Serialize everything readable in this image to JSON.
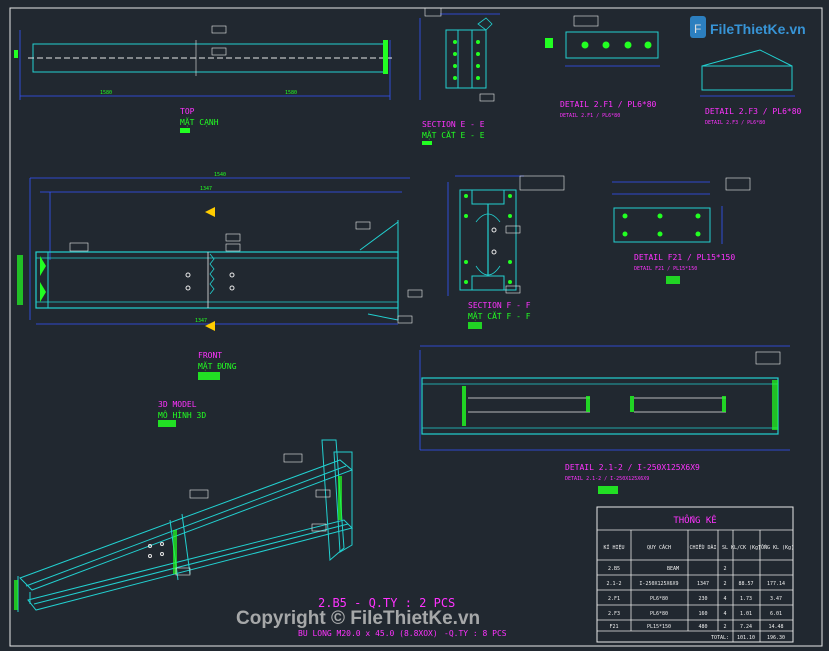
{
  "watermark": {
    "brand": "FileThietKe.vn",
    "copyright": "Copyright © FileThietKe.vn"
  },
  "views": {
    "top": {
      "title": "TOP",
      "subtitle": "MẶT CẠNH"
    },
    "section_ee": {
      "title": "SECTION E - E",
      "subtitle": "MẶT CẮT E - E"
    },
    "detail_2f1": {
      "title": "DETAIL 2.F1 / PL6*80",
      "subtitle": "DETAIL 2.F1 / PL6*80"
    },
    "detail_2f3": {
      "title": "DETAIL 2.F3 / PL6*80",
      "subtitle": "DETAIL 2.F3 / PL6*80"
    },
    "front": {
      "title": "FRONT",
      "subtitle": "MẶT ĐỨNG"
    },
    "section_ff": {
      "title": "SECTION F - F",
      "subtitle": "MẶT CẮT F - F"
    },
    "detail_f21": {
      "title": "DETAIL F21 / PL15*150",
      "subtitle": "DETAIL F21 / PL15*150"
    },
    "model3d": {
      "title": "3D MODEL",
      "subtitle": "MÔ HÌNH 3D"
    },
    "detail_212": {
      "title": "DETAIL 2.1-2 / I-250X125X6X9",
      "subtitle": "DETAIL 2.1-2 / I-250X125X6X9"
    }
  },
  "bottom": {
    "title": "2.B5 - Q.TY : 2 PCS",
    "bolt_note": "BU LONG M20.0 x 45.0 (8.8XOX)",
    "bolt_qty": "-Q.TY : 8 PCS"
  },
  "stats_table": {
    "title": "THỐNG KÊ",
    "headers": [
      "KÍ HIỆU",
      "QUY CÁCH",
      "CHIỀU DÀI",
      "SL",
      "KL/CK (Kg)",
      "TỔNG KL (Kg)"
    ],
    "rows": [
      [
        "2.B5",
        "BEAM",
        "",
        "2",
        "",
        ""
      ],
      [
        "2.1-2",
        "I-250X125X6X9",
        "1347",
        "2",
        "88.57",
        "177.14"
      ],
      [
        "2.F1",
        "PL6*80",
        "230",
        "4",
        "1.73",
        "3.47"
      ],
      [
        "2.F3",
        "PL6*80",
        "160",
        "4",
        "1.01",
        "6.01"
      ],
      [
        "F21",
        "PL15*150",
        "480",
        "2",
        "7.24",
        "14.48"
      ]
    ],
    "total_label": "TOTAL:",
    "total_weight": "101.10",
    "grand_total": "196.30"
  },
  "colors": {
    "background": "#212830",
    "border": "#d8d8d8",
    "geometry": "#22d0d0",
    "dimension": "#3355ff",
    "label_magenta": "#ff33ff",
    "label_green": "#22ff22"
  }
}
